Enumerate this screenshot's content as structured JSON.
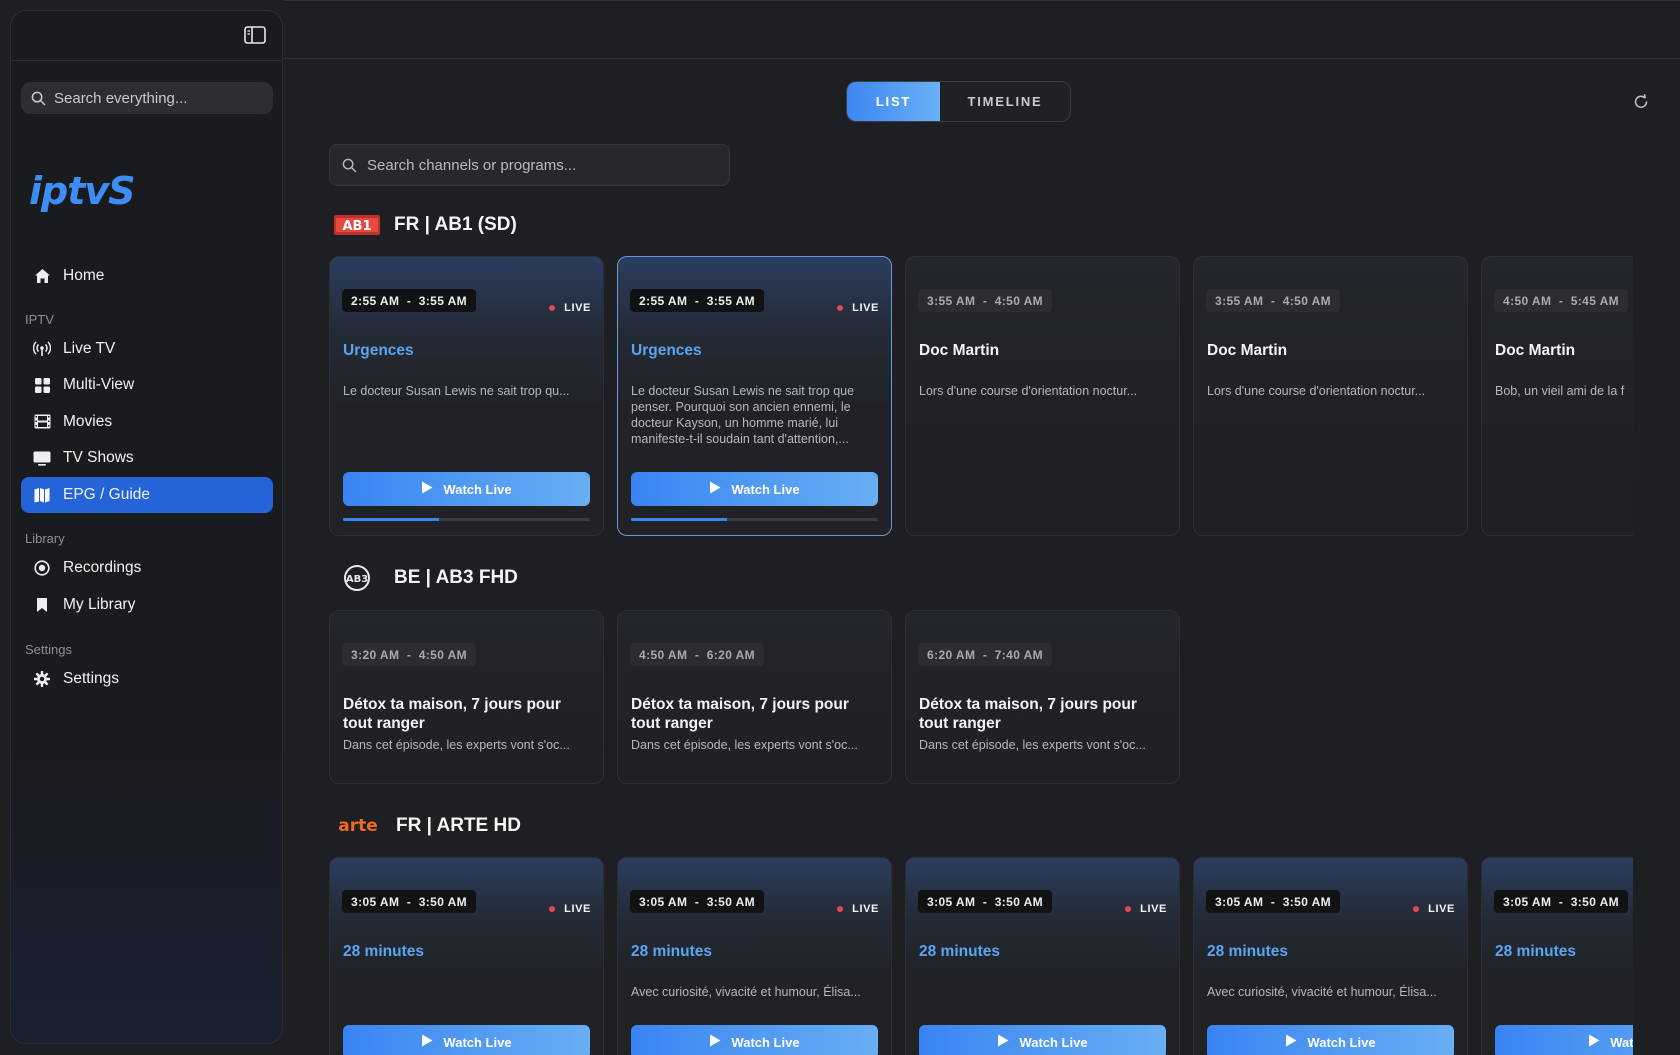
{
  "sidebar": {
    "search_placeholder": "Search everything...",
    "logo": "iptvS",
    "nav": {
      "home": "Home",
      "section_iptv": "IPTV",
      "live_tv": "Live TV",
      "multi_view": "Multi-View",
      "movies": "Movies",
      "tv_shows": "TV Shows",
      "epg_guide": "EPG / Guide",
      "section_library": "Library",
      "recordings": "Recordings",
      "my_library": "My Library",
      "section_settings": "Settings",
      "settings": "Settings"
    },
    "active_item": "EPG / Guide"
  },
  "main": {
    "view_toggle": {
      "list": "LIST",
      "timeline": "TIMELINE",
      "active": "LIST"
    },
    "search_placeholder": "Search channels or programs...",
    "live_label": "LIVE",
    "watch_label": "Watch Live",
    "channels": [
      {
        "name": "FR | AB1 (SD)",
        "logo_text": "AB1",
        "programs": [
          {
            "time": "2:55 AM  -  3:55 AM",
            "title": "Urgences",
            "desc": "Le docteur Susan Lewis ne sait trop qu...",
            "live": true,
            "progress": 0.39
          },
          {
            "time": "2:55 AM  -  3:55 AM",
            "title": "Urgences",
            "desc": "Le docteur Susan Lewis ne sait trop que penser. Pourquoi son ancien ennemi, le docteur Kayson, un homme marié, lui manifeste-t-il soudain tant d'attention,...",
            "live": true,
            "progress": 0.39
          },
          {
            "time": "3:55 AM  -  4:50 AM",
            "title": "Doc Martin",
            "desc": "Lors d'une course d'orientation noctur...",
            "live": false
          },
          {
            "time": "3:55 AM  -  4:50 AM",
            "title": "Doc Martin",
            "desc": "Lors d'une course d'orientation noctur...",
            "live": false
          },
          {
            "time": "4:50 AM  -  5:45 AM",
            "title": "Doc Martin",
            "desc": "Bob, un vieil ami de la f",
            "live": false
          }
        ]
      },
      {
        "name": "BE | AB3 FHD",
        "logo_text": "AB3",
        "programs": [
          {
            "time": "3:20 AM  -  4:50 AM",
            "title": "Détox ta maison, 7 jours pour tout ranger",
            "desc": "Dans cet épisode, les experts vont s'oc...",
            "live": false
          },
          {
            "time": "4:50 AM  -  6:20 AM",
            "title": "Détox ta maison, 7 jours pour tout ranger",
            "desc": "Dans cet épisode, les experts vont s'oc...",
            "live": false
          },
          {
            "time": "6:20 AM  -  7:40 AM",
            "title": "Détox ta maison, 7 jours pour tout ranger",
            "desc": "Dans cet épisode, les experts vont s'oc...",
            "live": false
          }
        ]
      },
      {
        "name": "FR | ARTE HD",
        "logo_text": "arte",
        "programs": [
          {
            "time": "3:05 AM  -  3:50 AM",
            "title": "28 minutes",
            "desc": "",
            "live": true
          },
          {
            "time": "3:05 AM  -  3:50 AM",
            "title": "28 minutes",
            "desc": "Avec curiosité, vivacité et humour, Élisa...",
            "live": true
          },
          {
            "time": "3:05 AM  -  3:50 AM",
            "title": "28 minutes",
            "desc": "",
            "live": true
          },
          {
            "time": "3:05 AM  -  3:50 AM",
            "title": "28 minutes",
            "desc": "Avec curiosité, vivacité et humour, Élisa...",
            "live": true
          },
          {
            "time": "3:05 AM  -  3:50 AM",
            "title": "28 minutes",
            "desc": "",
            "live": false
          },
          {
            "watch_label_truncated": "Watch"
          }
        ]
      }
    ]
  },
  "colors": {
    "accent": "#2464d8",
    "accent_light": "#5aa4f2",
    "live_dot": "#e5484d",
    "background": "#1d1f23",
    "arte_orange": "#f06a22",
    "ab1_red": "#d63a32"
  }
}
